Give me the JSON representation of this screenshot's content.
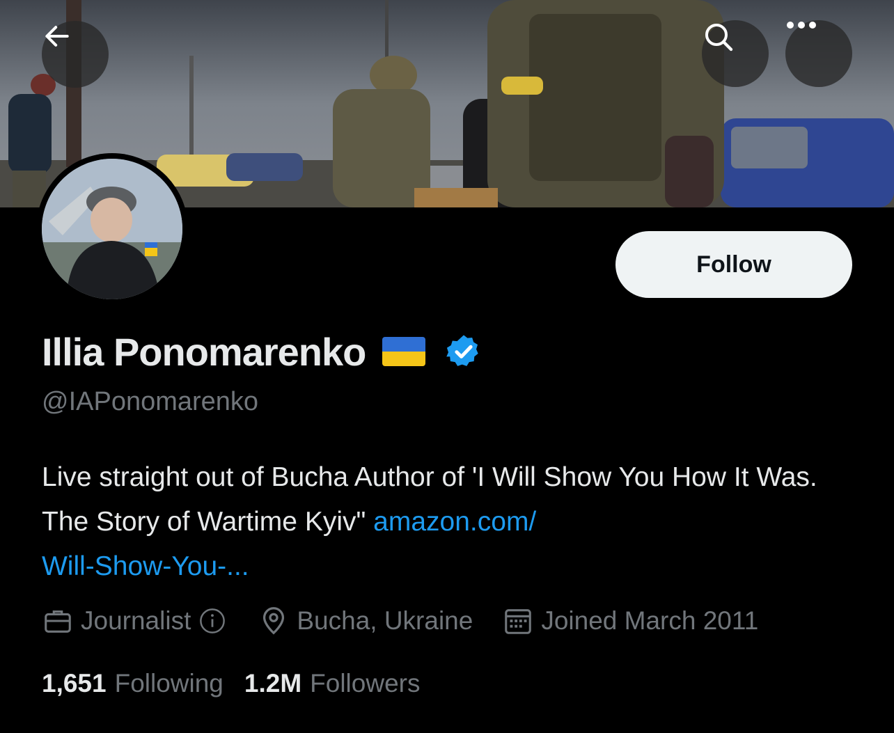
{
  "header": {
    "back_icon": "arrow-left-icon",
    "search_icon": "search-icon",
    "more_icon": "more-horizontal-icon"
  },
  "profile": {
    "name": "Illia Ponomarenko",
    "handle": "@IAPonomarenko",
    "follow_label": "Follow",
    "bio_text": "Live straight out of Bucha Author of 'I Will Show You How It Was. The Story of Wartime Kyiv\" ",
    "bio_link_line1": "amazon.com/",
    "bio_link_line2": "Will-Show-You-...",
    "profession": "Journalist",
    "location": "Bucha, Ukraine",
    "joined": "Joined March 2011",
    "following_count": "1,651",
    "following_label": "Following",
    "followers_count": "1.2M",
    "followers_label": "Followers"
  },
  "colors": {
    "link": "#1d9bf0",
    "verified": "#1d9bf0",
    "muted": "#71767b",
    "flag_blue": "#2f6fd4",
    "flag_yellow": "#f5c518"
  }
}
